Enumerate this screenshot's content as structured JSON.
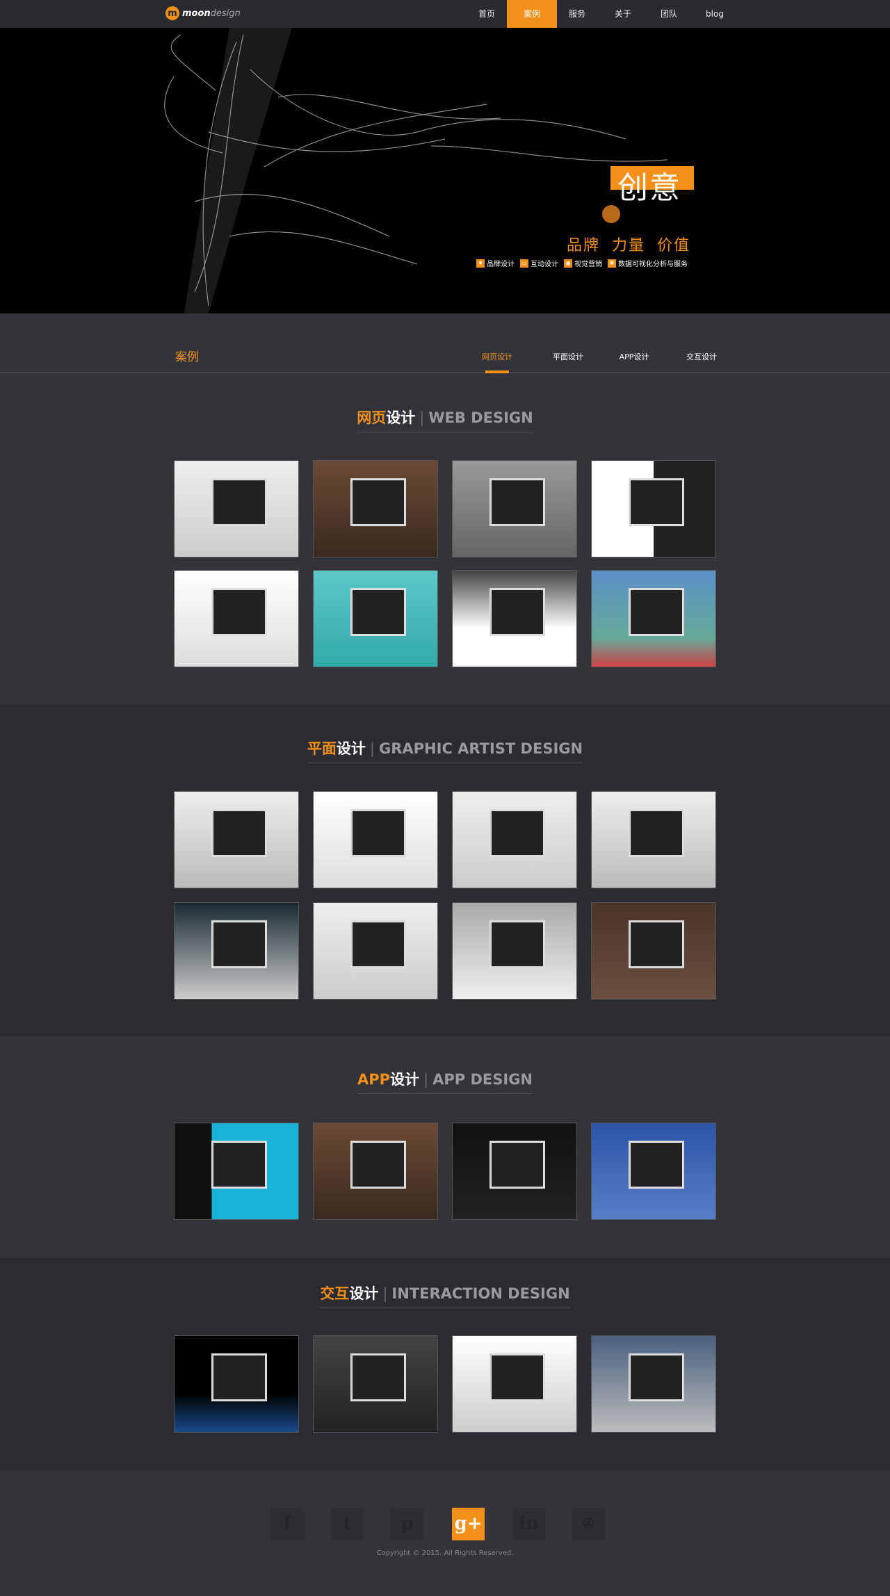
{
  "nav": {
    "logo_bold": "moon",
    "logo_light": "design",
    "items": [
      {
        "label": "首页"
      },
      {
        "label": "案例"
      },
      {
        "label": "服务"
      },
      {
        "label": "关于"
      },
      {
        "label": "团队"
      },
      {
        "label": "blog"
      }
    ],
    "active": 1
  },
  "hero": {
    "title": "创意",
    "slogan": "品牌 力量 价值",
    "services": [
      "品牌设计",
      "互动设计",
      "视觉营销",
      "数据可视化分析与服务"
    ]
  },
  "cases": {
    "title": "案例",
    "tabs": [
      "网页设计",
      "平面设计",
      "APP设计",
      "交互设计"
    ]
  },
  "sections": [
    {
      "cn_a": "网页",
      "cn_b": "设计",
      "sep": "|",
      "en": "WEB DESIGN"
    },
    {
      "cn_a": "平面",
      "cn_b": "设计",
      "sep": "|",
      "en": "GRAPHIC ARTIST DESIGN"
    },
    {
      "cn_a": "APP",
      "cn_b": "设计",
      "sep": "|",
      "en": "APP DESIGN"
    },
    {
      "cn_a": "交互",
      "cn_b": "设计",
      "sep": "|",
      "en": "INTERACTION DESIGN"
    }
  ],
  "footer": {
    "social": [
      "f",
      "t",
      "p",
      "g+",
      "in",
      "reel"
    ],
    "copyright": "Copyright © 2015. All Rights Reserved."
  },
  "colors": {
    "accent": "#f39019",
    "bg": "#33343a",
    "bg_dark": "#2b2c31"
  }
}
